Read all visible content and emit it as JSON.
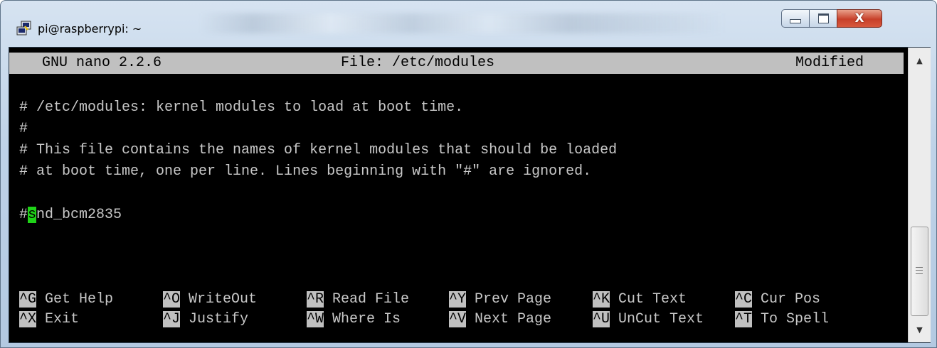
{
  "window": {
    "title": "pi@raspberrypi: ~",
    "icons": {
      "app": "putty-icon",
      "minimize": "minimize-icon",
      "maximize": "maximize-icon",
      "close": "close-icon"
    },
    "close_glyph": "X"
  },
  "nano": {
    "version": "GNU nano 2.2.6",
    "file_label": "File: /etc/modules",
    "status": "Modified",
    "lines": [
      "",
      "# /etc/modules: kernel modules to load at boot time.",
      "#",
      "# This file contains the names of kernel modules that should be loaded",
      "# at boot time, one per line. Lines beginning with \"#\" are ignored.",
      ""
    ],
    "cursor_line": {
      "prefix": "#",
      "cursor_char": "s",
      "suffix": "nd_bcm2835"
    },
    "shortcuts_row1": [
      {
        "key": "^G",
        "label": "Get Help"
      },
      {
        "key": "^O",
        "label": "WriteOut"
      },
      {
        "key": "^R",
        "label": "Read File"
      },
      {
        "key": "^Y",
        "label": "Prev Page"
      },
      {
        "key": "^K",
        "label": "Cut Text"
      },
      {
        "key": "^C",
        "label": "Cur Pos"
      }
    ],
    "shortcuts_row2": [
      {
        "key": "^X",
        "label": "Exit"
      },
      {
        "key": "^J",
        "label": "Justify"
      },
      {
        "key": "^W",
        "label": "Where Is"
      },
      {
        "key": "^V",
        "label": "Next Page"
      },
      {
        "key": "^U",
        "label": "UnCut Text"
      },
      {
        "key": "^T",
        "label": "To Spell"
      }
    ]
  },
  "colors": {
    "header_bg": "#c0c0c0",
    "cursor": "#1fd318",
    "terminal_bg": "#000000",
    "text": "#c8c8c8"
  }
}
